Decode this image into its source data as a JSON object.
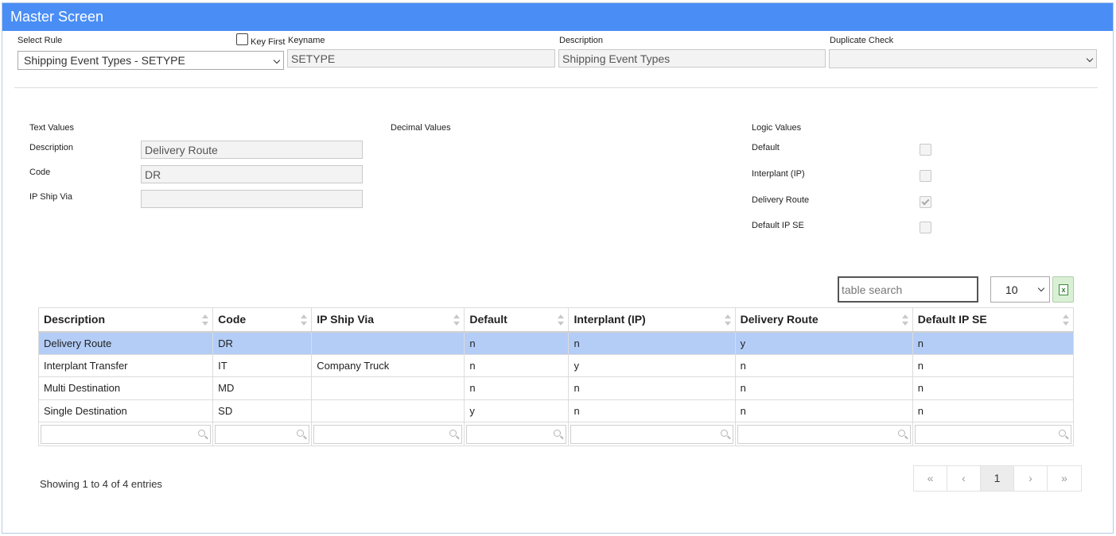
{
  "window": {
    "title": "Master Screen"
  },
  "top": {
    "select_rule_label": "Select Rule",
    "select_rule_value": "Shipping Event Types - SETYPE",
    "key_first_label": "Key First",
    "keyname_label": "Keyname",
    "keyname_value": "SETYPE",
    "description_label": "Description",
    "description_value": "Shipping Event Types",
    "duplicate_check_label": "Duplicate Check",
    "duplicate_check_value": ""
  },
  "text_values": {
    "heading": "Text Values",
    "fields": [
      {
        "label": "Description",
        "value": "Delivery Route"
      },
      {
        "label": "Code",
        "value": "DR"
      },
      {
        "label": "IP Ship Via",
        "value": ""
      }
    ]
  },
  "decimal_values": {
    "heading": "Decimal Values"
  },
  "logic_values": {
    "heading": "Logic Values",
    "fields": [
      {
        "label": "Default",
        "checked": false
      },
      {
        "label": "Interplant (IP)",
        "checked": false
      },
      {
        "label": "Delivery Route",
        "checked": true
      },
      {
        "label": "Default IP SE",
        "checked": false
      }
    ]
  },
  "table": {
    "search_placeholder": "table search",
    "page_length": "10",
    "excel_icon": "excel-export-icon",
    "columns": [
      "Description",
      "Code",
      "IP Ship Via",
      "Default",
      "Interplant (IP)",
      "Delivery Route",
      "Default IP SE"
    ],
    "rows": [
      [
        "Delivery Route",
        "DR",
        "",
        "n",
        "n",
        "y",
        "n"
      ],
      [
        "Interplant Transfer",
        "IT",
        "Company Truck",
        "n",
        "y",
        "n",
        "n"
      ],
      [
        "Multi Destination",
        "MD",
        "",
        "n",
        "n",
        "n",
        "n"
      ],
      [
        "Single Destination",
        "SD",
        "",
        "y",
        "n",
        "n",
        "n"
      ]
    ],
    "selected_row": 0,
    "info": "Showing 1 to 4 of 4 entries",
    "pagination": {
      "first": "«",
      "prev": "‹",
      "current": "1",
      "next": "›",
      "last": "»"
    }
  },
  "colors": {
    "titlebar": "#4a8ef5",
    "selected_row": "#b3cdf7"
  }
}
